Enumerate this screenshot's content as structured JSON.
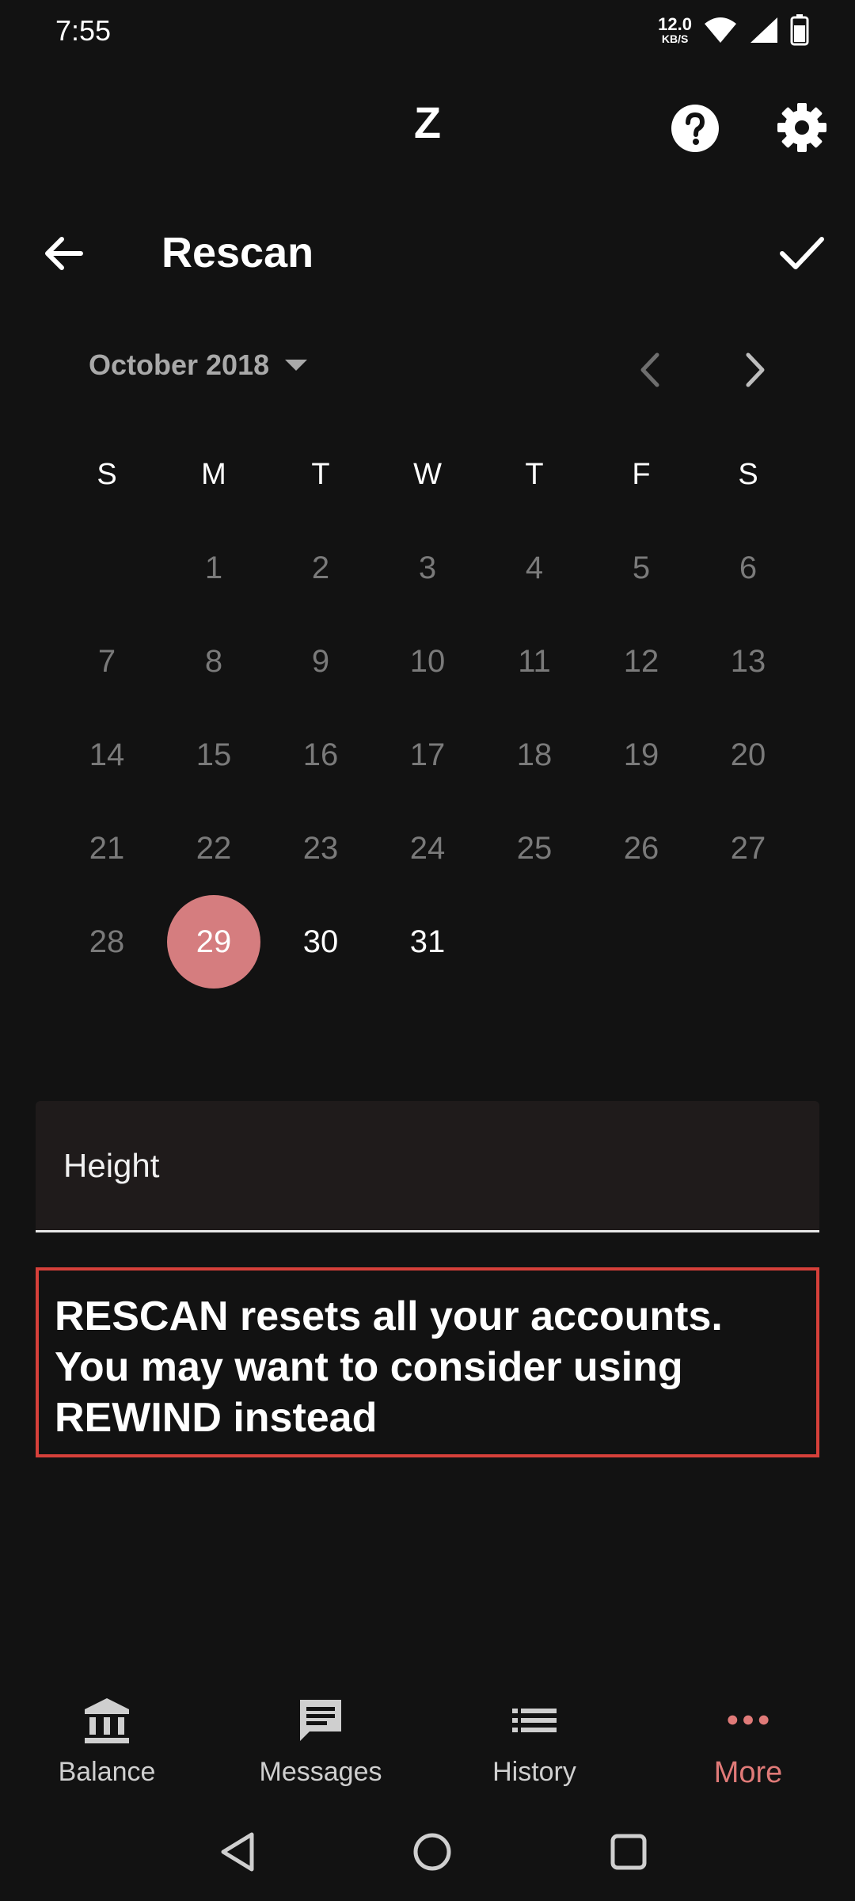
{
  "status_bar": {
    "time": "7:55",
    "net_speed_value": "12.0",
    "net_speed_unit": "KB/S",
    "icons": [
      "wifi-icon",
      "signal-icon",
      "battery-icon"
    ]
  },
  "app_bar": {
    "title": "Z",
    "icons": [
      "help-icon",
      "settings-icon"
    ]
  },
  "toolbar": {
    "title": "Rescan",
    "icons": [
      "back-arrow-icon",
      "check-icon"
    ]
  },
  "calendar": {
    "month_label": "October 2018",
    "weekdays": [
      "S",
      "M",
      "T",
      "W",
      "T",
      "F",
      "S"
    ],
    "first_day_offset": 1,
    "days_in_month": 31,
    "selected_day": "29",
    "enabled_days": [
      "29",
      "30",
      "31"
    ]
  },
  "height_field": {
    "label": "Height"
  },
  "warning": {
    "text": "RESCAN resets all your accounts. You may want to consider using REWIND instead",
    "border_color": "#d6403a"
  },
  "bottom_nav": {
    "items": [
      {
        "label": "Balance",
        "icon": "bank-icon"
      },
      {
        "label": "Messages",
        "icon": "message-icon"
      },
      {
        "label": "History",
        "icon": "list-icon"
      },
      {
        "label": "More",
        "icon": "more-dots-icon"
      }
    ],
    "active_index": 3
  },
  "colors": {
    "background": "#121212",
    "accent": "#d57d7f",
    "accent_text": "#e07a78",
    "muted_day": "#7a7a7a",
    "field_bg": "#1f1b1b"
  }
}
